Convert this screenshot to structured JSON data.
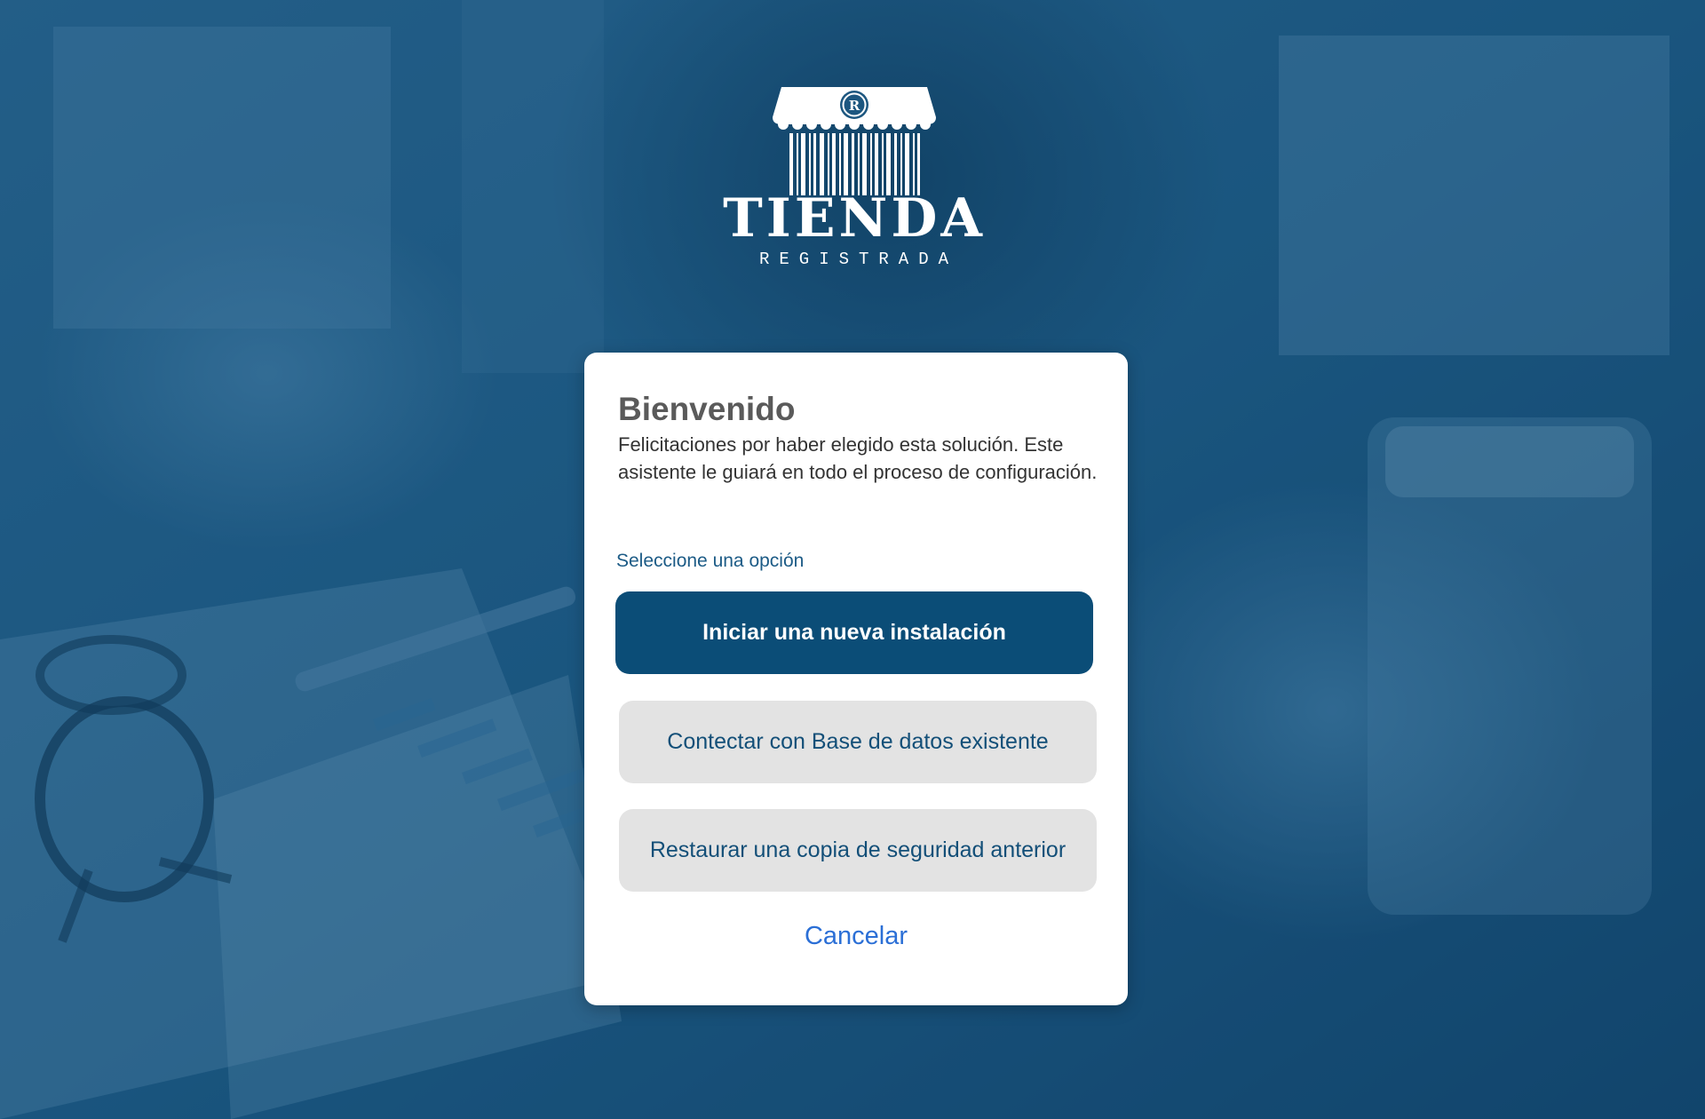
{
  "brand": {
    "title": "TIENDA",
    "subtitle": "REGISTRADA",
    "registered_mark": "R"
  },
  "welcome": {
    "title": "Bienvenido",
    "description": "Felicitaciones por haber elegido esta solución. Este asistente le guiará en todo el proceso de configuración.",
    "section_label": "Seleccione una opción"
  },
  "options": {
    "new_install": "Iniciar una nueva instalación",
    "connect_db": "Contectar con Base de datos existente",
    "restore_backup": "Restaurar una copia de seguridad anterior"
  },
  "cancel_label": "Cancelar",
  "colors": {
    "primary": "#0b4d77",
    "secondary_button": "#e3e3e3",
    "link": "#2b6fd6",
    "background": "#1d5780"
  },
  "icons": {
    "logo": "storefront-barcode-logo"
  }
}
